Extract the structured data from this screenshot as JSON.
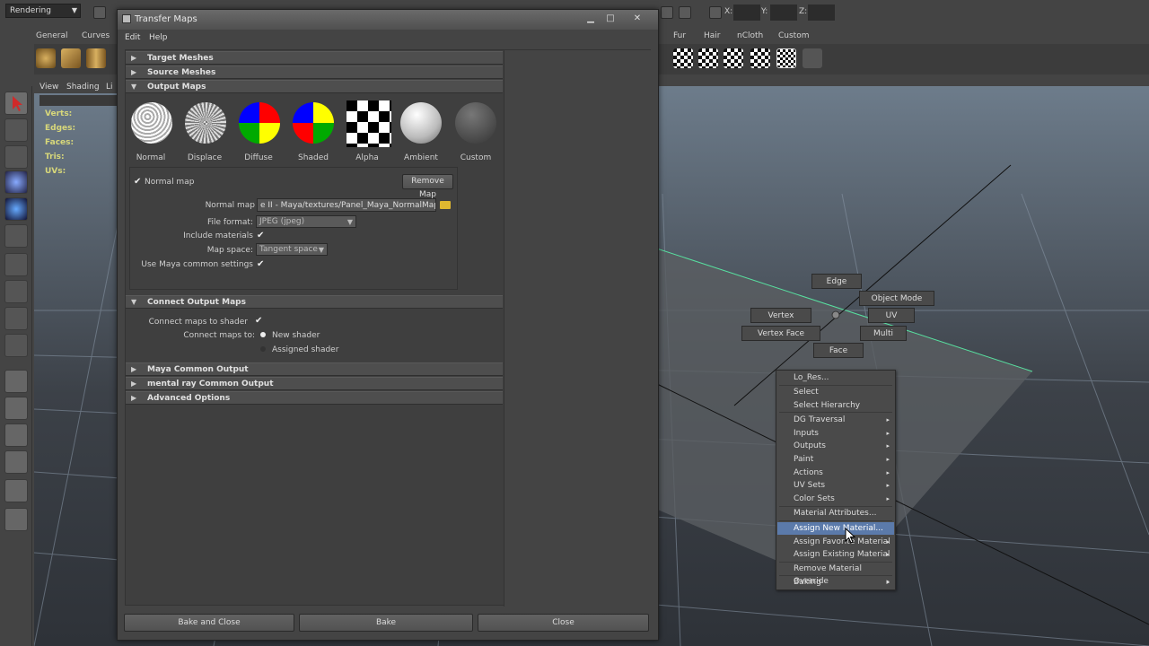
{
  "topbar": {
    "mode_combo": "Rendering",
    "x_label": "X:",
    "y_label": "Y:",
    "z_label": "Z:"
  },
  "shelf": {
    "tabs": [
      "General",
      "Curves",
      "Fur",
      "Hair",
      "nCloth",
      "Custom"
    ]
  },
  "viewport": {
    "menu": [
      "View",
      "Shading",
      "Li"
    ],
    "hud": [
      "Verts:",
      "Edges:",
      "Faces:",
      "Tris:",
      "UVs:"
    ]
  },
  "dialog": {
    "title": "Transfer Maps",
    "menu": [
      "Edit",
      "Help"
    ],
    "sections": {
      "target_meshes": "Target Meshes",
      "source_meshes": "Source Meshes",
      "output_maps": "Output Maps",
      "connect_output_maps": "Connect Output Maps",
      "maya_common_output": "Maya Common Output",
      "mental_ray_common_output": "mental ray Common Output",
      "advanced_options": "Advanced Options"
    },
    "map_types": [
      "Normal",
      "Displace",
      "Diffuse",
      "Shaded",
      "Alpha",
      "Ambient",
      "Custom"
    ],
    "normal_map": {
      "checkbox_label": "Normal map",
      "remove_button": "Remove Map",
      "path_label": "Normal map",
      "path_value": "e II - Maya/textures/Panel_Maya_NormalMap.jpg",
      "file_format_label": "File format:",
      "file_format_value": "JPEG (jpeg)",
      "include_materials_label": "Include materials",
      "map_space_label": "Map space:",
      "map_space_value": "Tangent space",
      "use_common_label": "Use Maya common settings"
    },
    "connect": {
      "connect_label": "Connect maps to shader",
      "connect_to_label": "Connect maps to:",
      "option_new": "New shader",
      "option_assigned": "Assigned shader"
    },
    "buttons": {
      "bake_close": "Bake and Close",
      "bake": "Bake",
      "close": "Close"
    }
  },
  "marking_menu": {
    "edge": "Edge",
    "object_mode": "Object Mode",
    "vertex": "Vertex",
    "uv": "UV",
    "vertex_face": "Vertex Face",
    "multi": "Multi",
    "face": "Face"
  },
  "context_menu": {
    "items": [
      {
        "label": "Lo_Res...",
        "sub": false
      },
      {
        "label": "Select",
        "sub": false
      },
      {
        "label": "Select Hierarchy",
        "sub": false
      },
      {
        "label": "DG Traversal",
        "sub": true
      },
      {
        "label": "Inputs",
        "sub": true
      },
      {
        "label": "Outputs",
        "sub": true
      },
      {
        "label": "Paint",
        "sub": true
      },
      {
        "label": "Actions",
        "sub": true
      },
      {
        "label": "UV Sets",
        "sub": true
      },
      {
        "label": "Color Sets",
        "sub": true
      },
      {
        "label": "Material Attributes...",
        "sub": false
      },
      {
        "label": "Assign New Material...",
        "sub": false
      },
      {
        "label": "Assign Favorite Material",
        "sub": true
      },
      {
        "label": "Assign Existing Material",
        "sub": true
      },
      {
        "label": "Remove Material Override",
        "sub": true
      },
      {
        "label": "Baking",
        "sub": true
      }
    ],
    "highlighted": "Assign New Material..."
  }
}
